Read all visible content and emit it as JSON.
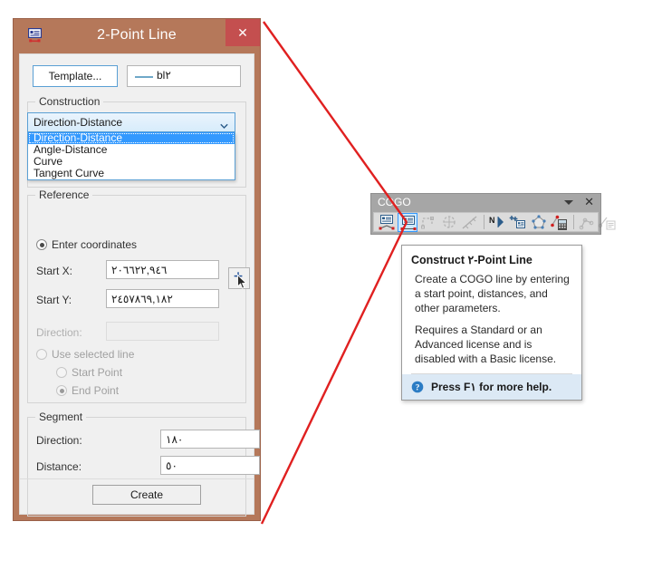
{
  "dialog": {
    "title": "2-Point Line",
    "app_icon": "line-properties-icon",
    "close_label": "✕",
    "template": {
      "button_label": "Template...",
      "preview_label": "bl٢",
      "preview_icon": "line-symbol-icon"
    },
    "construction": {
      "group_label": "Construction",
      "selected": "Direction-Distance",
      "options": [
        "Direction-Distance",
        "Angle-Distance",
        "Curve",
        "Tangent Curve"
      ],
      "dropdown_icon": "chevron-down-icon"
    },
    "reference": {
      "group_label": "Reference",
      "enter_coordinates_label": "Enter coordinates",
      "enter_coordinates_checked": true,
      "start_x_label": "Start X:",
      "start_x_value": "٢٠٦٦٢٢,٩٤٦",
      "start_y_label": "Start Y:",
      "start_y_value": "٢٤٥٧٨٦٩,١٨٢",
      "direction_label": "Direction:",
      "direction_value": "",
      "direction_disabled": true,
      "pick_button_icon": "pick-coordinate-icon",
      "cursor_icon": "mouse-pointer-icon",
      "use_selected_line_label": "Use selected line",
      "use_selected_line_checked": false,
      "start_point_label": "Start Point",
      "start_point_checked": false,
      "end_point_label": "End Point",
      "end_point_checked": true
    },
    "segment": {
      "group_label": "Segment",
      "direction_label": "Direction:",
      "direction_value": "١٨٠",
      "distance_label": "Distance:",
      "distance_value": "٥٠"
    },
    "create_label": "Create"
  },
  "cogo_toolbar": {
    "title": "COGO",
    "caret_icon": "chevron-down-icon",
    "close_label": "✕",
    "buttons": [
      {
        "name": "construct-point-line-icon",
        "enabled": true,
        "active": false
      },
      {
        "name": "construct-2-point-line-icon",
        "enabled": true,
        "active": true
      },
      {
        "name": "construct-traverse-icon",
        "enabled": false,
        "active": false
      },
      {
        "name": "construct-curve-icon",
        "enabled": false,
        "active": false
      },
      {
        "name": "construct-tangent-curve-icon",
        "enabled": false,
        "active": false
      },
      {
        "name": "north-direction-icon",
        "enabled": true,
        "active": false
      },
      {
        "name": "add-coordinate-icon",
        "enabled": true,
        "active": false
      },
      {
        "name": "construct-polygon-icon",
        "enabled": true,
        "active": false
      },
      {
        "name": "cogo-calculator-icon",
        "enabled": true,
        "active": false
      },
      {
        "name": "traverse-adjust-icon",
        "enabled": false,
        "active": false
      },
      {
        "name": "traverse-report-icon",
        "enabled": false,
        "active": false
      }
    ]
  },
  "tooltip": {
    "title": "Construct ٢-Point Line",
    "body": "Create a COGO line by entering a start point, distances, and other parameters.",
    "note": "Requires a Standard or an Advanced license and is disabled with a Basic license.",
    "footer": "Press F١ for more help.",
    "help_icon": "help-circle-icon"
  },
  "annotation": {
    "color": "#e02020",
    "name": "callout-lines"
  },
  "colors": {
    "dialog_frame": "#b5785a",
    "close_button": "#c44f4f",
    "accent_blue": "#3399ff",
    "toolbar_bg": "#a6a6a6",
    "tooltip_footer": "#dce9f5"
  }
}
